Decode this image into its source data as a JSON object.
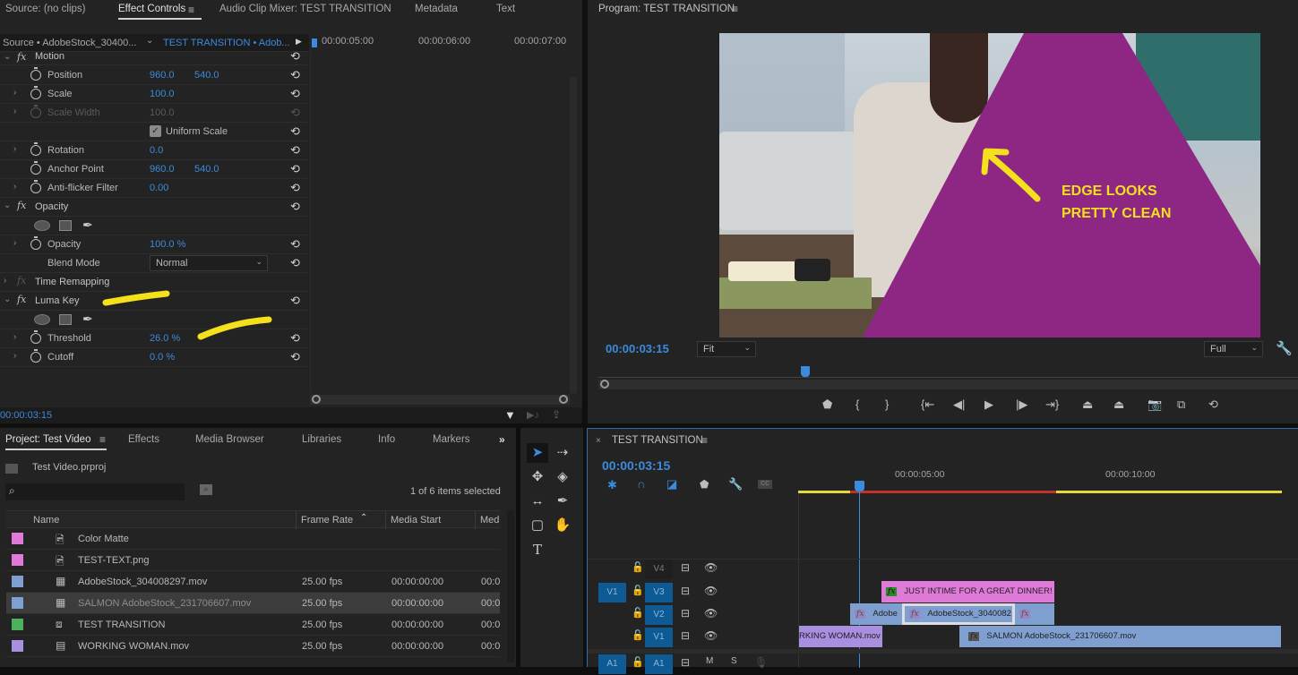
{
  "top_left_panel": {
    "tabs": [
      {
        "label": "Source: (no clips)"
      },
      {
        "label": "Effect Controls",
        "active": true
      },
      {
        "label": "Audio Clip Mixer: TEST TRANSITION"
      },
      {
        "label": "Metadata"
      },
      {
        "label": "Text"
      }
    ],
    "source_label": "Source • AdobeStock_30400...",
    "sequence_label": "TEST TRANSITION • Adob...",
    "ruler_times": [
      "00:00:05:00",
      "00:00:06:00",
      "00:00:07:00"
    ],
    "current_time": "00:00:03:15",
    "effects": {
      "motion": {
        "label": "Motion",
        "position": {
          "label": "Position",
          "x": "960.0",
          "y": "540.0"
        },
        "scale": {
          "label": "Scale",
          "value": "100.0"
        },
        "scale_width": {
          "label": "Scale Width",
          "value": "100.0"
        },
        "uniform_scale": {
          "label": "Uniform Scale",
          "checked": true
        },
        "rotation": {
          "label": "Rotation",
          "value": "0.0"
        },
        "anchor_point": {
          "label": "Anchor Point",
          "x": "960.0",
          "y": "540.0"
        },
        "anti_flicker": {
          "label": "Anti-flicker Filter",
          "value": "0.00"
        }
      },
      "opacity": {
        "label": "Opacity",
        "opacity": {
          "label": "Opacity",
          "value": "100.0 %"
        },
        "blend_mode": {
          "label": "Blend Mode",
          "value": "Normal"
        }
      },
      "time_remapping": {
        "label": "Time Remapping"
      },
      "luma_key": {
        "label": "Luma Key",
        "threshold": {
          "label": "Threshold",
          "value": "26.0 %"
        },
        "cutoff": {
          "label": "Cutoff",
          "value": "0.0 %"
        }
      }
    }
  },
  "program_monitor": {
    "title": "Program: TEST TRANSITION",
    "annotation": [
      "EDGE LOOKS",
      "PRETTY CLEAN"
    ],
    "timecode": "00:00:03:15",
    "zoom": "Fit",
    "resolution": "Full",
    "playhead_fraction": 0.29,
    "colors": {
      "overlay": "#8e2784",
      "annotation": "#f5e11b"
    }
  },
  "project_panel": {
    "tabs": [
      {
        "label": "Project: Test Video",
        "active": true
      },
      {
        "label": "Effects"
      },
      {
        "label": "Media Browser"
      },
      {
        "label": "Libraries"
      },
      {
        "label": "Info"
      },
      {
        "label": "Markers"
      }
    ],
    "project_file": "Test Video.prproj",
    "search_placeholder": "",
    "selection_status": "1 of 6 items selected",
    "columns": [
      "Name",
      "Frame Rate",
      "Media Start",
      "Med"
    ],
    "items": [
      {
        "color": "#e07ad8",
        "type": "still",
        "name": "Color Matte",
        "frame_rate": "",
        "media_start": "",
        "media_end": ""
      },
      {
        "color": "#e07ad8",
        "type": "still",
        "name": "TEST-TEXT.png",
        "frame_rate": "",
        "media_start": "",
        "media_end": ""
      },
      {
        "color": "#7f9fd0",
        "type": "av",
        "name": "AdobeStock_304008297.mov",
        "frame_rate": "25.00 fps",
        "media_start": "00:00:00:00",
        "media_end": "00:0"
      },
      {
        "color": "#7f9fd0",
        "type": "av",
        "name": "SALMON AdobeStock_231706607.mov",
        "frame_rate": "25.00 fps",
        "media_start": "00:00:00:00",
        "media_end": "00:0",
        "selected": true
      },
      {
        "color": "#4cb05c",
        "type": "sequence",
        "name": "TEST TRANSITION",
        "frame_rate": "25.00 fps",
        "media_start": "00:00:00:00",
        "media_end": "00:0"
      },
      {
        "color": "#a98fe0",
        "type": "video",
        "name": "WORKING WOMAN.mov",
        "frame_rate": "25.00 fps",
        "media_start": "00:00:00:00",
        "media_end": "00:0"
      }
    ]
  },
  "timeline": {
    "title": "TEST TRANSITION",
    "timecode": "00:00:03:15",
    "ruler_times": [
      "00:00:05:00",
      "00:00:10:00"
    ],
    "tracks": [
      {
        "source": "",
        "name": "V4",
        "targeted": false
      },
      {
        "source": "V1",
        "name": "V3",
        "targeted": true
      },
      {
        "source": "",
        "name": "V2",
        "targeted": true
      },
      {
        "source": "",
        "name": "V1",
        "targeted": true
      },
      {
        "source": "A1",
        "name": "A1",
        "targeted": true,
        "audio": true,
        "mute": "M",
        "solo": "S"
      }
    ],
    "clips": {
      "v3": [
        {
          "label": "JUST INTIME FOR A GREAT DINNER!",
          "color": "#e07ad8"
        }
      ],
      "v2": [
        {
          "label": "Adobe",
          "color": "#7f9fd0"
        },
        {
          "label": "AdobeStock_3040082",
          "color": "#7f9fd0"
        },
        {
          "label": "",
          "color": "#7f9fd0"
        }
      ],
      "v1": [
        {
          "label": "RKING WOMAN.mov",
          "color": "#a98fe0"
        },
        {
          "label": "SALMON AdobeStock_231706607.mov",
          "color": "#7f9fd0"
        }
      ]
    }
  }
}
